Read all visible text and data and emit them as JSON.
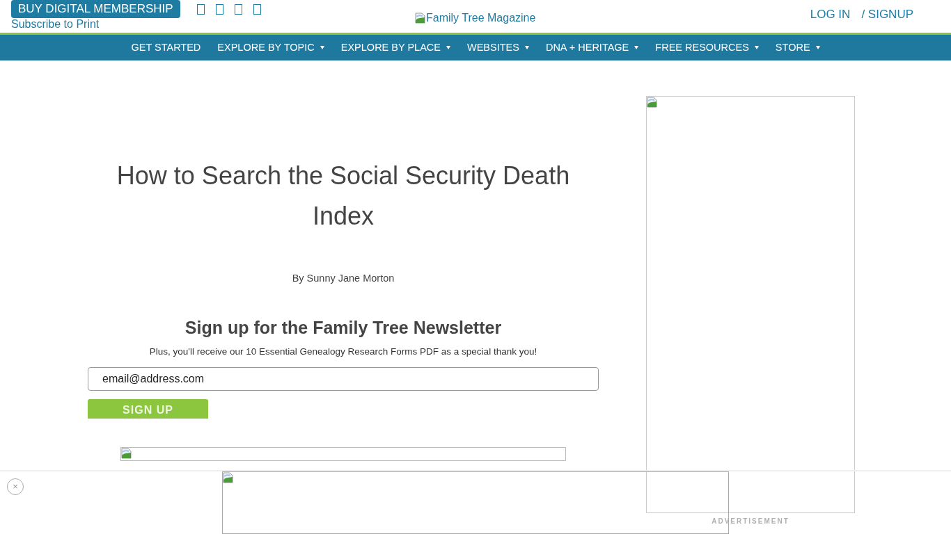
{
  "header": {
    "membership_button": "BUY DIGITAL MEMBERSHIP",
    "subscribe_link": "Subscribe to Print",
    "logo_alt": "Family Tree Magazine",
    "login": "LOG IN",
    "signup": "/ SIGNUP"
  },
  "nav": [
    {
      "label": "GET STARTED",
      "dropdown": false
    },
    {
      "label": "EXPLORE BY TOPIC",
      "dropdown": true
    },
    {
      "label": "EXPLORE BY PLACE",
      "dropdown": true
    },
    {
      "label": "WEBSITES",
      "dropdown": true
    },
    {
      "label": "DNA + HERITAGE",
      "dropdown": true
    },
    {
      "label": "FREE RESOURCES",
      "dropdown": true
    },
    {
      "label": "STORE",
      "dropdown": true
    }
  ],
  "article": {
    "title": "How to Search the Social Security Death Index",
    "byline": "By Sunny Jane Morton"
  },
  "newsletter": {
    "heading": "Sign up for the Family Tree Newsletter",
    "subtext": "Plus, you'll receive our 10 Essential Genealogy Research Forms PDF as a special thank you!",
    "email_value": "email@address.com",
    "button": "SIGN UP"
  },
  "sidebar_ad": {
    "label": "ADVERTISEMENT"
  },
  "bottom_ad": {
    "close_button": "×"
  }
}
